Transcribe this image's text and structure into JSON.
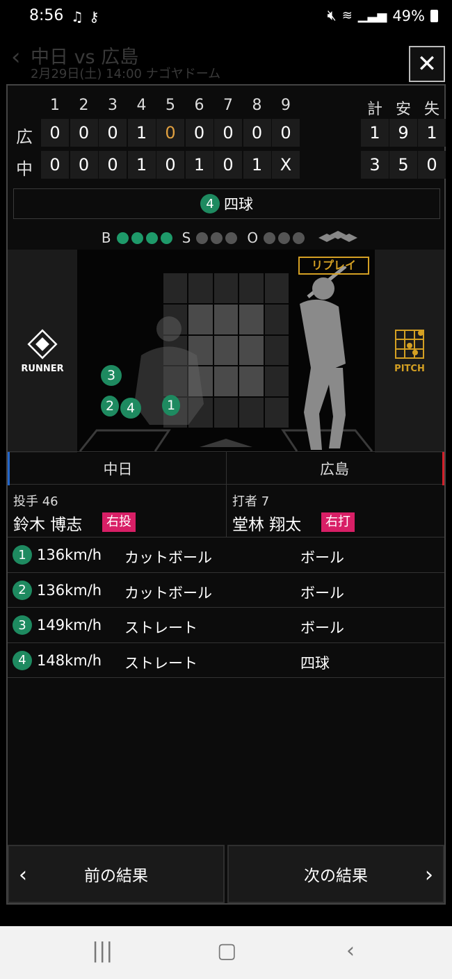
{
  "status_bar": {
    "time": "8:56",
    "battery": "49%"
  },
  "background_header": {
    "title": "中日 vs 広島",
    "subtitle": "2月29日(土) 14:00 ナゴヤドーム"
  },
  "scoreboard": {
    "innings": [
      "1",
      "2",
      "3",
      "4",
      "5",
      "6",
      "7",
      "8",
      "9"
    ],
    "totals_headers": [
      "計",
      "安",
      "失"
    ],
    "rows": [
      {
        "team": "広",
        "scores": [
          "0",
          "0",
          "0",
          "1",
          "0",
          "0",
          "0",
          "0",
          "0"
        ],
        "totals": [
          "1",
          "9",
          "1"
        ]
      },
      {
        "team": "中",
        "scores": [
          "0",
          "0",
          "0",
          "1",
          "0",
          "1",
          "0",
          "1",
          "X"
        ],
        "totals": [
          "3",
          "5",
          "0"
        ]
      }
    ]
  },
  "result": {
    "number": "4",
    "text": "四球"
  },
  "count": {
    "b_label": "B",
    "s_label": "S",
    "o_label": "O",
    "balls": 4,
    "strikes": 0,
    "outs": 0
  },
  "field": {
    "runner_label": "RUNNER",
    "pitch_label": "PITCH",
    "replay_label": "リプレイ"
  },
  "teams": {
    "home": "中日",
    "away": "広島"
  },
  "pitcher": {
    "role": "投手 46",
    "name": "鈴木 博志",
    "hand": "右投"
  },
  "batter": {
    "role": "打者 7",
    "name": "堂林 翔太",
    "hand": "右打"
  },
  "pitches": [
    {
      "num": "1",
      "speed": "136km/h",
      "type": "カットボール",
      "result": "ボール"
    },
    {
      "num": "2",
      "speed": "136km/h",
      "type": "カットボール",
      "result": "ボール"
    },
    {
      "num": "3",
      "speed": "149km/h",
      "type": "ストレート",
      "result": "ボール"
    },
    {
      "num": "4",
      "speed": "148km/h",
      "type": "ストレート",
      "result": "四球"
    }
  ],
  "nav": {
    "prev": "前の結果",
    "next": "次の結果"
  }
}
